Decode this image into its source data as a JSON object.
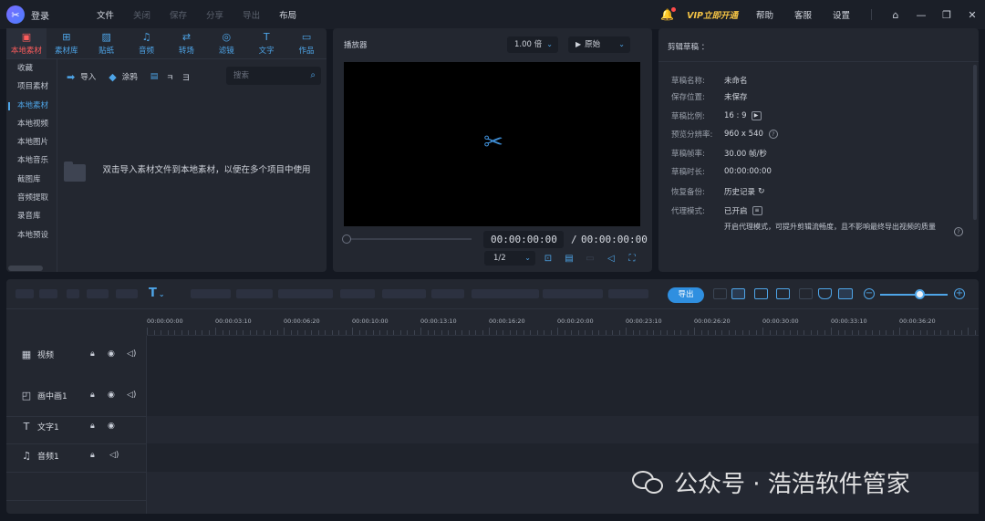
{
  "titlebar": {
    "login": "登录",
    "menu": [
      "文件",
      "关闭",
      "保存",
      "分享",
      "导出",
      "布局"
    ],
    "vip": "VIP立即开通",
    "right_menu": [
      "帮助",
      "客服",
      "设置"
    ]
  },
  "media": {
    "tabs": [
      {
        "label": "本地素材",
        "icon": "local-media-icon"
      },
      {
        "label": "素材库",
        "icon": "library-icon"
      },
      {
        "label": "贴纸",
        "icon": "sticker-icon"
      },
      {
        "label": "音频",
        "icon": "music-icon"
      },
      {
        "label": "转场",
        "icon": "transition-icon"
      },
      {
        "label": "滤镜",
        "icon": "filter-icon"
      },
      {
        "label": "文字",
        "icon": "text-icon"
      },
      {
        "label": "作品",
        "icon": "works-icon"
      }
    ],
    "sidebar": [
      "收藏",
      "项目素材",
      "本地素材",
      "本地视频",
      "本地图片",
      "本地音乐",
      "截图库",
      "音频提取",
      "录音库",
      "本地预设"
    ],
    "toolbar": {
      "import": "导入",
      "paint": "涂鸦",
      "sort1": "ㅋ",
      "sort2": "ヨ"
    },
    "search_placeholder": "搜索",
    "empty_text": "双击导入素材文件到本地素材，以便在多个项目中使用"
  },
  "player": {
    "title": "播放器",
    "speed": "1.00 倍",
    "ratio": "原始",
    "current_time": "00:00:00:00",
    "separator": "/",
    "total_time": "00:00:00:00",
    "quality": "1/2"
  },
  "info": {
    "title": "剪辑草稿 ：",
    "rows": [
      {
        "label": "草稿名称:",
        "value": "未命名"
      },
      {
        "label": "保存位置:",
        "value": "未保存"
      },
      {
        "label": "草稿比例:",
        "value": "16 : 9"
      },
      {
        "label": "预览分辨率:",
        "value": "960 x 540"
      },
      {
        "label": "草稿帧率:",
        "value": "30.00 帧/秒"
      },
      {
        "label": "草稿时长:",
        "value": "00:00:00:00"
      },
      {
        "label": "恢复备份:",
        "value": "历史记录"
      },
      {
        "label": "代理模式:",
        "value": "已开启"
      }
    ],
    "proxy_note": "开启代理模式，可提升剪辑流畅度，且不影响最终导出视频的质量"
  },
  "timeline": {
    "export_label": "导出",
    "ticks": [
      "00:00:00:00",
      "00:00:03:10",
      "00:00:06:20",
      "00:00:10:00",
      "00:00:13:10",
      "00:00:16:20",
      "00:00:20:00",
      "00:00:23:10",
      "00:00:26:20",
      "00:00:30:00",
      "00:00:33:10",
      "00:00:36:20"
    ],
    "zoom_level": 0.55,
    "tracks": [
      {
        "name": "视频",
        "icon": "film-icon"
      },
      {
        "name": "画中画1",
        "icon": "pip-icon"
      },
      {
        "name": "文字1",
        "icon": "text-icon"
      },
      {
        "name": "音频1",
        "icon": "music-icon"
      }
    ]
  },
  "watermark": "公众号 · 浩浩软件管家",
  "colors": {
    "accent": "#4ea5e8",
    "active_tab": "#ff5c5c",
    "vip": "#f5c445",
    "export": "#2f8fe0"
  }
}
